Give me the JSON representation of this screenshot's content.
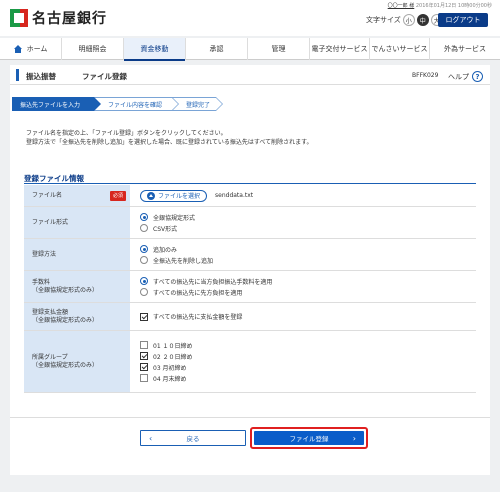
{
  "header": {
    "bank_name": "名古屋銀行",
    "user_name": "〇〇一郎 様",
    "last_login": "2016年01月12日 10時00分00秒",
    "font_size_label": "文字サイズ",
    "font_sizes": [
      "小",
      "中",
      "大"
    ],
    "font_size_selected": "中",
    "logout_label": "ログアウト"
  },
  "nav": {
    "items": [
      {
        "label": "ホーム",
        "icon": "home-icon"
      },
      {
        "label": "明細照会"
      },
      {
        "label": "資金移動",
        "active": true
      },
      {
        "label": "承認"
      },
      {
        "label": "管理"
      },
      {
        "label": "電子交付サービス"
      },
      {
        "label": "でんさいサービス"
      },
      {
        "label": "外為サービス"
      }
    ]
  },
  "page": {
    "title": "振込振替",
    "subtitle": "ファイル登録",
    "screen_id": "BFFK029",
    "help_label": "ヘルプ",
    "help_icon": "?"
  },
  "steps": [
    {
      "label": "振込先ファイルを入力",
      "current": true
    },
    {
      "label": "ファイル内容を確認"
    },
    {
      "label": "登録完了"
    }
  ],
  "description": {
    "line1": "ファイル名を指定の上、「ファイル登録」ボタンをクリックしてください。",
    "line2": "登録方法で「全振込先を削除し追加」を選択した場合、既に登録されている振込先はすべて削除されます。"
  },
  "form": {
    "section_title": "登録ファイル情報",
    "file_name": {
      "label": "ファイル名",
      "required_badge": "必須",
      "button_label": "ファイルを選択",
      "value": "senddata.txt"
    },
    "file_format": {
      "label": "ファイル形式",
      "options": [
        "全銀協規定形式",
        "CSV形式"
      ],
      "selected": "全銀協規定形式"
    },
    "register_method": {
      "label": "登録方法",
      "options": [
        "追加のみ",
        "全振込先を削除し追加"
      ],
      "selected": "追加のみ"
    },
    "fee": {
      "label_line1": "手数料",
      "label_line2": "（全銀協規定形式のみ）",
      "options": [
        "すべての振込先に当方負担振込手数料を適用",
        "すべての振込先に先方負担を適用"
      ],
      "selected": "すべての振込先に当方負担振込手数料を適用"
    },
    "payment_amount": {
      "label_line1": "登録支払金額",
      "label_line2": "（全銀協規定形式のみ）",
      "checkbox_label": "すべての振込先に支払金額を登録",
      "checked": true
    },
    "group": {
      "label_line1": "所属グループ",
      "label_line2": "（全銀協規定形式のみ）",
      "options": [
        {
          "label": "01 １０日締め",
          "checked": false
        },
        {
          "label": "02 ２０日締め",
          "checked": true
        },
        {
          "label": "03 月初締め",
          "checked": true
        },
        {
          "label": "04 月末締め",
          "checked": false
        }
      ]
    }
  },
  "buttons": {
    "back_label": "戻る",
    "submit_label": "ファイル登録"
  }
}
